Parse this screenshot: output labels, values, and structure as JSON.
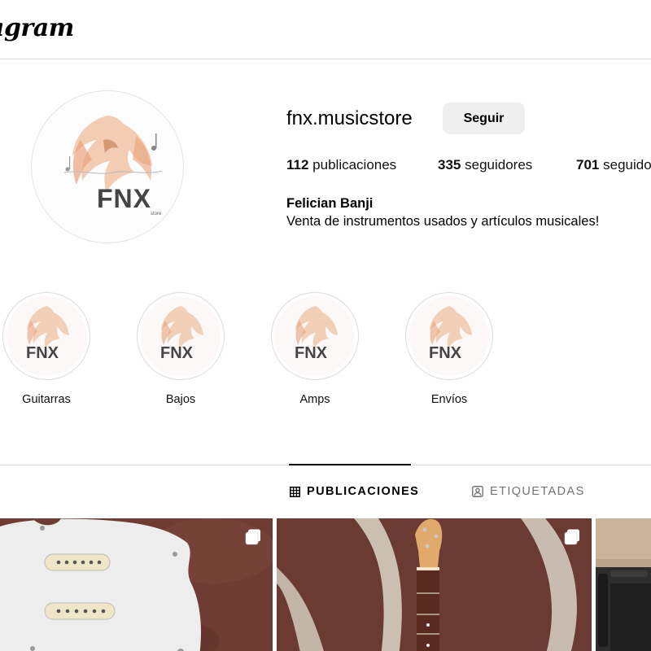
{
  "header": {
    "logo_text": "Instagram"
  },
  "profile": {
    "username": "fnx.musicstore",
    "follow_label": "Seguir",
    "stats": [
      {
        "count": "112",
        "label": "publicaciones"
      },
      {
        "count": "335",
        "label": "seguidores"
      },
      {
        "count": "701",
        "label": "seguidos"
      }
    ],
    "full_name": "Felician Banji",
    "bio": "Venta de instrumentos usados y artículos musicales!",
    "avatar_logo_text": "FNX",
    "avatar_logo_subtext": "store"
  },
  "highlights": [
    {
      "label": "Guitarras",
      "logo_text": "FNX"
    },
    {
      "label": "Bajos",
      "logo_text": "FNX"
    },
    {
      "label": "Amps",
      "logo_text": "FNX"
    },
    {
      "label": "Envíos",
      "logo_text": "FNX"
    }
  ],
  "tabs": [
    {
      "label": "PUBLICACIONES",
      "icon": "grid-icon",
      "active": true
    },
    {
      "label": "ETIQUETADAS",
      "icon": "tagged-icon",
      "active": false
    }
  ],
  "posts": [
    {
      "subject": "guitar-pickguard-photo",
      "multi": true
    },
    {
      "subject": "guitar-neck-photo",
      "multi": true
    },
    {
      "subject": "amplifier-photo",
      "multi": false
    }
  ],
  "colors": {
    "border": "#dbdbdb",
    "button_bg": "#efefef",
    "muted_text": "#737373",
    "carpet": "#6b3a32",
    "logo_orange": "#e8a27a"
  }
}
